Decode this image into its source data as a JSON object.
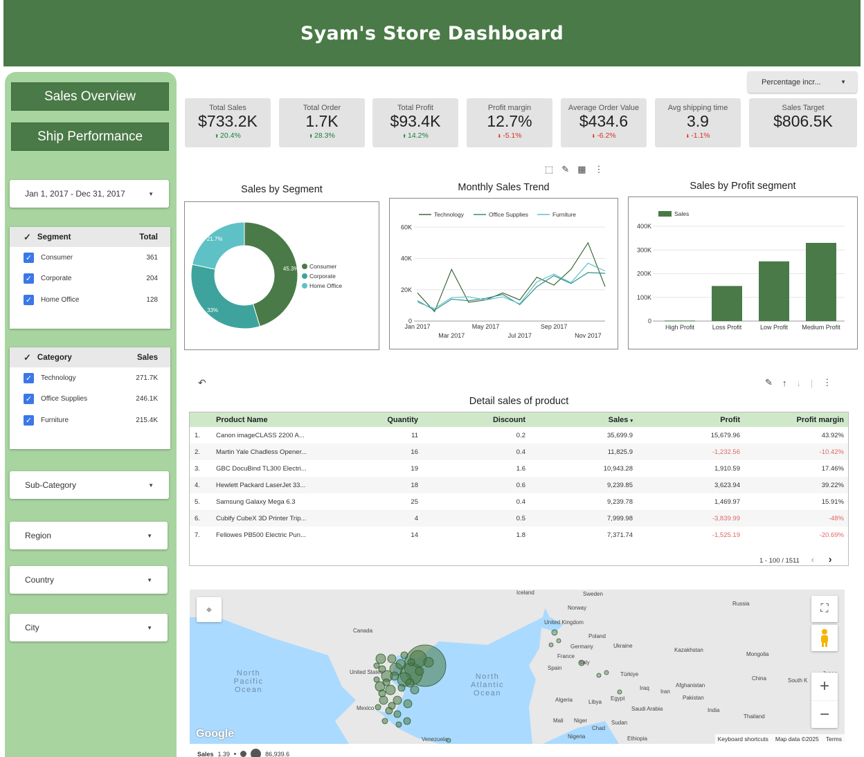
{
  "header": {
    "title": "Syam's Store Dashboard"
  },
  "nav": {
    "sales_overview": "Sales Overview",
    "ship_performance": "Ship Performance"
  },
  "filters": {
    "date_range": "Jan 1, 2017 - Dec 31, 2017",
    "sub_category": "Sub-Category",
    "region": "Region",
    "country": "Country",
    "city": "City",
    "percentage_dropdown": "Percentage incr..."
  },
  "segment_control": {
    "header": "Segment",
    "total_header": "Total",
    "items": [
      {
        "label": "Consumer",
        "value": "361"
      },
      {
        "label": "Corporate",
        "value": "204"
      },
      {
        "label": "Home Office",
        "value": "128"
      }
    ]
  },
  "category_control": {
    "header": "Category",
    "total_header": "Sales",
    "items": [
      {
        "label": "Technology",
        "value": "271.7K"
      },
      {
        "label": "Office Supplies",
        "value": "246.1K"
      },
      {
        "label": "Furniture",
        "value": "215.4K"
      }
    ]
  },
  "kpis": [
    {
      "title": "Total Sales",
      "value": "$733.2K",
      "delta": "20.4%",
      "dir": "up"
    },
    {
      "title": "Total Order",
      "value": "1.7K",
      "delta": "28.3%",
      "dir": "up"
    },
    {
      "title": "Total Profit",
      "value": "$93.4K",
      "delta": "14.2%",
      "dir": "up"
    },
    {
      "title": "Profit margin",
      "value": "12.7%",
      "delta": "-5.1%",
      "dir": "down"
    },
    {
      "title": "Average Order Value",
      "value": "$434.6",
      "delta": "-6.2%",
      "dir": "down"
    },
    {
      "title": "Avg shipping time",
      "value": "3.9",
      "delta": "-1.1%",
      "dir": "down"
    },
    {
      "title": "Sales Target",
      "value": "$806.5K",
      "delta": "",
      "dir": ""
    }
  ],
  "chart_data": [
    {
      "type": "pie",
      "title": "Sales by Segment",
      "categories": [
        "Consumer",
        "Corporate",
        "Home Office"
      ],
      "values": [
        45.3,
        33,
        21.7
      ],
      "slice_labels": [
        "45.3%",
        "33%",
        "21.7%"
      ],
      "colors": [
        "#4a7a47",
        "#3ea39c",
        "#5ec1c6"
      ],
      "legend": "right"
    },
    {
      "type": "line",
      "title": "Monthly Sales Trend",
      "x": [
        "Jan 2017",
        "Feb 2017",
        "Mar 2017",
        "Apr 2017",
        "May 2017",
        "Jun 2017",
        "Jul 2017",
        "Aug 2017",
        "Sep 2017",
        "Oct 2017",
        "Nov 2017",
        "Dec 2017"
      ],
      "x_tick_labels_top": [
        "Jan 2017",
        "May 2017",
        "Sep 2017"
      ],
      "x_tick_labels_bottom": [
        "Mar 2017",
        "Jul 2017",
        "Nov 2017"
      ],
      "y_ticks": [
        "0",
        "20K",
        "40K",
        "60K"
      ],
      "ylim": [
        0,
        65000
      ],
      "series": [
        {
          "name": "Technology",
          "color": "#3d6a3a",
          "values": [
            18000,
            6000,
            33000,
            12000,
            13500,
            18000,
            13500,
            28000,
            23000,
            33000,
            50000,
            22000
          ]
        },
        {
          "name": "Office Supplies",
          "color": "#2f8f8a",
          "values": [
            13000,
            7000,
            14000,
            13000,
            14500,
            17000,
            10500,
            22000,
            29000,
            24000,
            31000,
            30500
          ]
        },
        {
          "name": "Furniture",
          "color": "#5ec1c6",
          "values": [
            12000,
            8000,
            15000,
            15500,
            13500,
            15500,
            11000,
            25000,
            30000,
            24500,
            37000,
            32000
          ]
        }
      ],
      "legend": "top"
    },
    {
      "type": "bar",
      "title": "Sales by Profit segment",
      "categories": [
        "High Profit",
        "Loss Profit",
        "Low Profit",
        "Medium Profit"
      ],
      "series": [
        {
          "name": "Sales",
          "values": [
            2000,
            148000,
            252000,
            330000
          ],
          "color": "#4a7a47"
        }
      ],
      "y_ticks": [
        "0",
        "100K",
        "200K",
        "300K",
        "400K"
      ],
      "ylim": [
        0,
        400000
      ],
      "legend": "top-left"
    }
  ],
  "table": {
    "title": "Detail sales of product",
    "columns": [
      "Product Name",
      "Quantity",
      "Discount",
      "Sales",
      "Profit",
      "Profit margin"
    ],
    "sort_indicator": "▾",
    "rows": [
      {
        "n": "1.",
        "name": "Canon imageCLASS 2200 A...",
        "qty": "11",
        "disc": "0.2",
        "sales": "35,699.9",
        "profit": "15,679.96",
        "margin": "43.92%",
        "neg": false
      },
      {
        "n": "2.",
        "name": "Martin Yale Chadless Opener...",
        "qty": "16",
        "disc": "0.4",
        "sales": "11,825.9",
        "profit": "-1,232.56",
        "margin": "-10.42%",
        "neg": true
      },
      {
        "n": "3.",
        "name": "GBC DocuBind TL300 Electri...",
        "qty": "19",
        "disc": "1.6",
        "sales": "10,943.28",
        "profit": "1,910.59",
        "margin": "17.46%",
        "neg": false
      },
      {
        "n": "4.",
        "name": "Hewlett Packard LaserJet 33...",
        "qty": "18",
        "disc": "0.6",
        "sales": "9,239.85",
        "profit": "3,623.94",
        "margin": "39.22%",
        "neg": false
      },
      {
        "n": "5.",
        "name": "Samsung Galaxy Mega 6.3",
        "qty": "25",
        "disc": "0.4",
        "sales": "9,239.78",
        "profit": "1,469.97",
        "margin": "15.91%",
        "neg": false
      },
      {
        "n": "6.",
        "name": "Cubify CubeX 3D Printer Trip...",
        "qty": "4",
        "disc": "0.5",
        "sales": "7,999.98",
        "profit": "-3,839.99",
        "margin": "-48%",
        "neg": true
      },
      {
        "n": "7.",
        "name": "Fellowes PB500 Electric Pun...",
        "qty": "14",
        "disc": "1.8",
        "sales": "7,371.74",
        "profit": "-1,525.19",
        "margin": "-20.69%",
        "neg": true
      }
    ],
    "pagination": "1 - 100 / 1511"
  },
  "map": {
    "labels": {
      "iceland": "Iceland",
      "sweden": "Sweden",
      "russia": "Russia",
      "norway": "Norway",
      "canada": "Canada",
      "uk": "United Kingdom",
      "poland": "Poland",
      "germany": "Germany",
      "ukraine": "Ukraine",
      "kazakhstan": "Kazakhstan",
      "mongolia": "Mongolia",
      "france": "France",
      "spain": "Spain",
      "italy": "Italy",
      "turkiye": "Türkiye",
      "usa": "United States",
      "npo": "North Pacific Ocean",
      "nao": "North Atlantic Ocean",
      "china": "China",
      "japan": "Japan",
      "south_korea": "South K",
      "iraq": "Iraq",
      "iran": "Iran",
      "afghanistan": "Afghanistan",
      "pakistan": "Pakistan",
      "algeria": "Algeria",
      "libya": "Libya",
      "egypt": "Egypt",
      "saudi": "Saudi Arabia",
      "india": "India",
      "thailand": "Thailand",
      "mexico": "Mexico",
      "mali": "Mali",
      "niger": "Niger",
      "chad": "Chad",
      "sudan": "Sudan",
      "nigeria": "Nigeria",
      "ethiopia": "Ethiopia",
      "venezuela": "Venezuela"
    },
    "footer": {
      "shortcuts": "Keyboard shortcuts",
      "data": "Map data ©2025",
      "terms": "Terms"
    },
    "brand": "Google",
    "legend": {
      "label": "Sales",
      "min": "1.39",
      "max": "86,939.6"
    }
  }
}
